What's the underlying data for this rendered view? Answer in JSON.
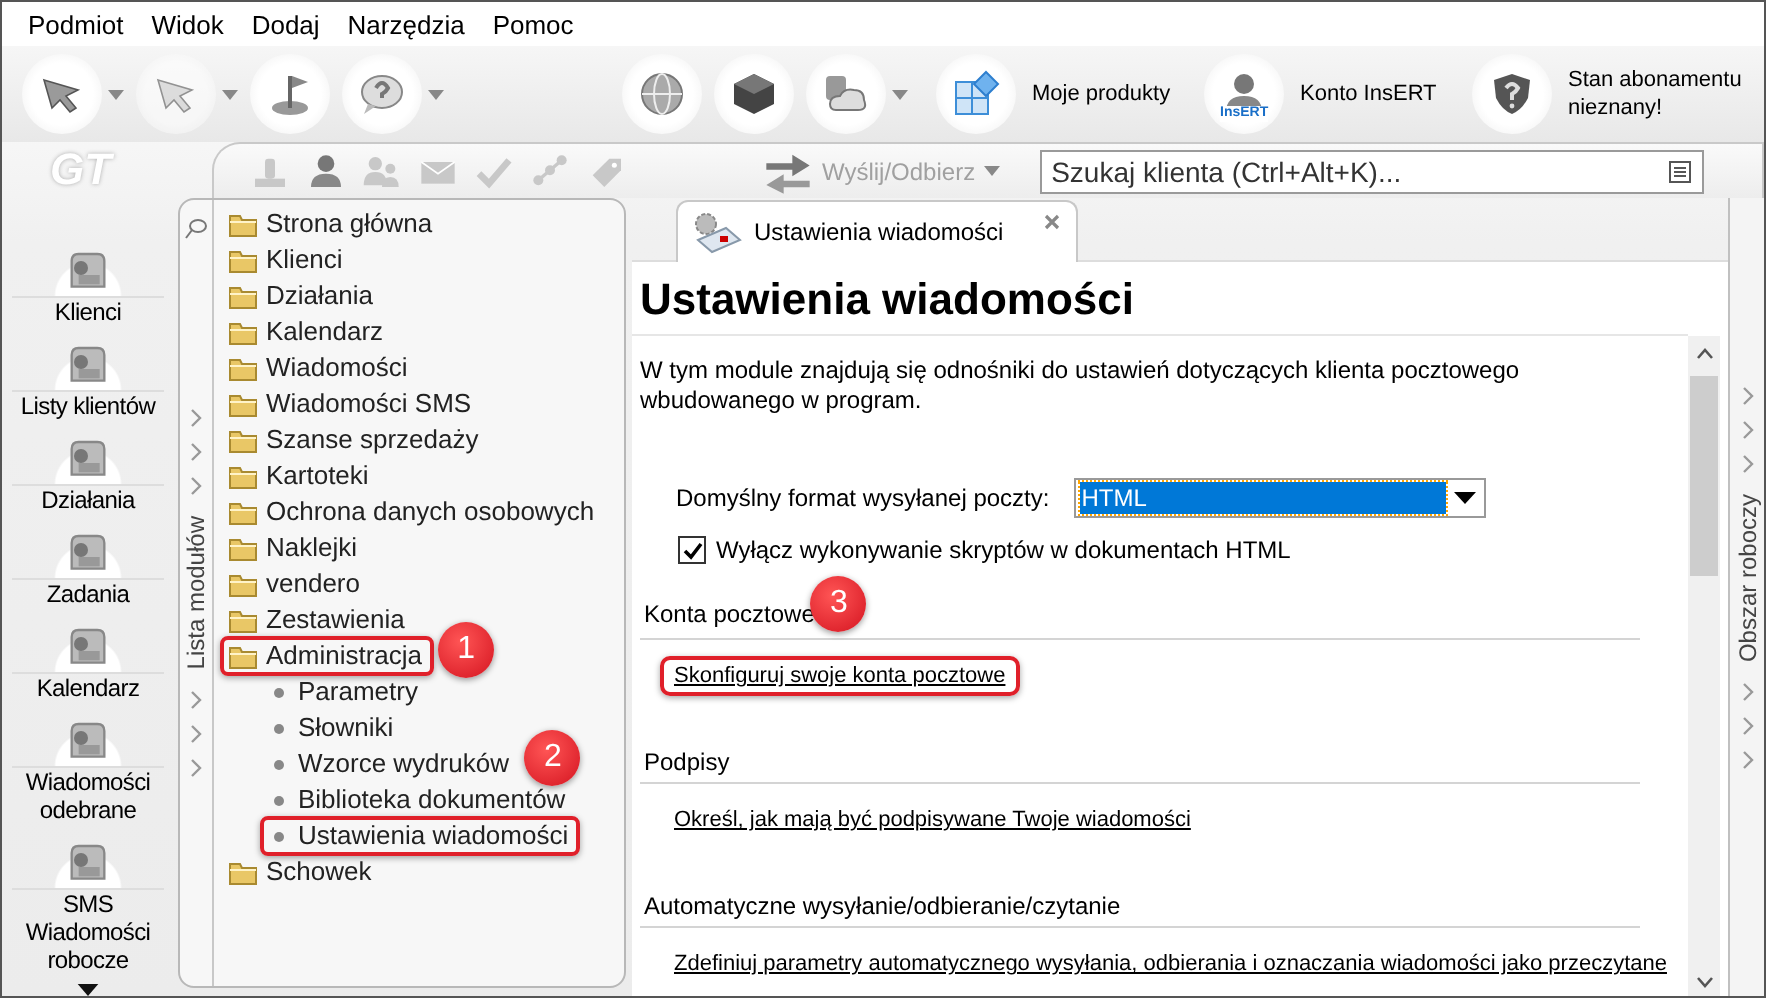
{
  "menu": [
    "Podmiot",
    "Widok",
    "Dodaj",
    "Narzędzia",
    "Pomoc"
  ],
  "toolbar": [
    {
      "kind": "arrow",
      "dropdown": true,
      "disabled": false
    },
    {
      "kind": "arrow",
      "dropdown": true,
      "disabled": true
    },
    {
      "kind": "flag",
      "dropdown": false,
      "disabled": false
    },
    {
      "kind": "help",
      "dropdown": true,
      "disabled": false
    },
    {
      "kind": "globe",
      "dropdown": false,
      "disabled": false
    },
    {
      "kind": "cube",
      "dropdown": false,
      "disabled": false
    },
    {
      "kind": "cloud",
      "dropdown": true,
      "disabled": false
    },
    {
      "kind": "tiles",
      "dropdown": false,
      "disabled": false,
      "label": "Moje produkty"
    },
    {
      "kind": "person",
      "dropdown": false,
      "disabled": false,
      "label": "Konto InsERT",
      "caption": "InsERT"
    },
    {
      "kind": "shield",
      "dropdown": false,
      "disabled": false,
      "label": "Stan abonamentu nieznany!"
    }
  ],
  "logo": "GT",
  "quick_actions": [
    {
      "kind": "stamp"
    },
    {
      "kind": "person"
    },
    {
      "kind": "people"
    },
    {
      "kind": "envelope"
    },
    {
      "kind": "check"
    },
    {
      "kind": "network"
    },
    {
      "kind": "tag"
    }
  ],
  "send_receive": {
    "label": "Wyślij/Odbierz",
    "disabled": true
  },
  "search": {
    "placeholder": "Szukaj klienta (Ctrl+Alt+K)..."
  },
  "nav": [
    {
      "label": "Klienci"
    },
    {
      "label": "Listy klientów"
    },
    {
      "label": "Działania"
    },
    {
      "label": "Zadania"
    },
    {
      "label": "Kalendarz"
    },
    {
      "label": "Wiadomości odebrane"
    },
    {
      "label": "SMS Wiadomości robocze"
    }
  ],
  "modules_panel": {
    "title": "Lista modułów",
    "items": [
      {
        "label": "Strona główna"
      },
      {
        "label": "Klienci"
      },
      {
        "label": "Działania"
      },
      {
        "label": "Kalendarz"
      },
      {
        "label": "Wiadomości"
      },
      {
        "label": "Wiadomości SMS"
      },
      {
        "label": "Szanse sprzedaży"
      },
      {
        "label": "Kartoteki"
      },
      {
        "label": "Ochrona danych osobowych"
      },
      {
        "label": "Naklejki"
      },
      {
        "label": "vendero"
      },
      {
        "label": "Zestawienia"
      },
      {
        "label": "Administracja",
        "highlighted": true,
        "callout": "1",
        "children": [
          {
            "label": "Parametry",
            "highlighted": false
          },
          {
            "label": "Słowniki",
            "highlighted": false
          },
          {
            "label": "Wzorce wydruków",
            "highlighted": false,
            "callout": "2"
          },
          {
            "label": "Biblioteka dokumentów",
            "highlighted": false
          },
          {
            "label": "Ustawienia wiadomości",
            "highlighted": true
          }
        ]
      },
      {
        "label": "Schowek"
      }
    ]
  },
  "workspace_panel": {
    "title": "Obszar roboczy"
  },
  "tabs": [
    {
      "label": "Ustawienia wiadomości",
      "selected": true
    }
  ],
  "page": {
    "title": "Ustawienia wiadomości",
    "description": "W tym module znajdują się odnośniki do ustawień dotyczących klienta pocztowego wbudowanego w program.",
    "format_field": {
      "label": "Domyślny format wysyłanej poczty:",
      "value": "HTML"
    },
    "scripts_checkbox": {
      "label": "Wyłącz wykonywanie skryptów w dokumentach HTML",
      "checked": true
    },
    "sections": [
      {
        "title": "Konta pocztowe",
        "callout": "3",
        "link": {
          "text": "Skonfiguruj swoje konta pocztowe",
          "highlighted": true
        }
      },
      {
        "title": "Podpisy",
        "link": {
          "text": "Określ, jak mają być podpisywane Twoje wiadomości",
          "highlighted": false
        }
      },
      {
        "title": "Automatyczne wysyłanie/odbieranie/czytanie",
        "link": {
          "text": "Zdefiniuj parametry automatycznego wysyłania, odbierania i oznaczania wiadomości jako przeczytane",
          "highlighted": false
        }
      }
    ]
  }
}
